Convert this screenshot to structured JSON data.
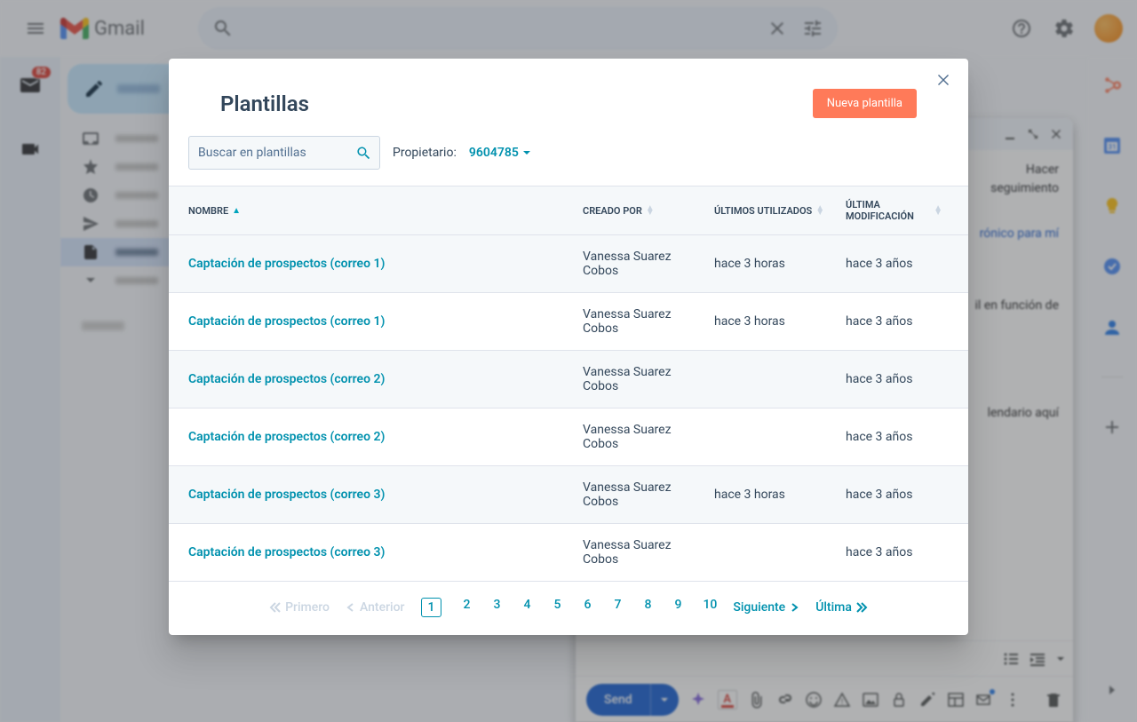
{
  "app": {
    "name": "Gmail"
  },
  "search": {
    "placeholder": ""
  },
  "left_rail": {
    "mail_badge": "82"
  },
  "compose_window": {
    "send_label": "Send",
    "body_fragments": {
      "a": "Hacer",
      "b": "seguimiento",
      "c": "rónico para mí",
      "d": "il en función de",
      "e": "lendario aquí"
    }
  },
  "modal": {
    "title": "Plantillas",
    "new_button": "Nueva plantilla",
    "search_placeholder": "Buscar en plantillas",
    "owner_label": "Propietario:",
    "owner_value": "9604785",
    "columns": {
      "name": "NOMBRE",
      "created_by": "CREADO POR",
      "last_used": "ÚLTIMOS UTILIZADOS",
      "last_modified": "ÚLTIMA MODIFICACIÓN"
    },
    "rows": [
      {
        "name": "Captación de prospectos (correo 1)",
        "created_by": "Vanessa Suarez Cobos",
        "last_used": "hace 3 horas",
        "last_modified": "hace 3 años"
      },
      {
        "name": "Captación de prospectos (correo 1)",
        "created_by": "Vanessa Suarez Cobos",
        "last_used": "hace 3 horas",
        "last_modified": "hace 3 años"
      },
      {
        "name": "Captación de prospectos (correo 2)",
        "created_by": "Vanessa Suarez Cobos",
        "last_used": "",
        "last_modified": "hace 3 años"
      },
      {
        "name": "Captación de prospectos (correo 2)",
        "created_by": "Vanessa Suarez Cobos",
        "last_used": "",
        "last_modified": "hace 3 años"
      },
      {
        "name": "Captación de prospectos (correo 3)",
        "created_by": "Vanessa Suarez Cobos",
        "last_used": "hace 3 horas",
        "last_modified": "hace 3 años"
      },
      {
        "name": "Captación de prospectos (correo 3)",
        "created_by": "Vanessa Suarez Cobos",
        "last_used": "",
        "last_modified": "hace 3 años"
      }
    ],
    "pagination": {
      "first": "Primero",
      "prev": "Anterior",
      "pages": [
        "1",
        "2",
        "3",
        "4",
        "5",
        "6",
        "7",
        "8",
        "9",
        "10"
      ],
      "next": "Siguiente",
      "last": "Última"
    }
  }
}
